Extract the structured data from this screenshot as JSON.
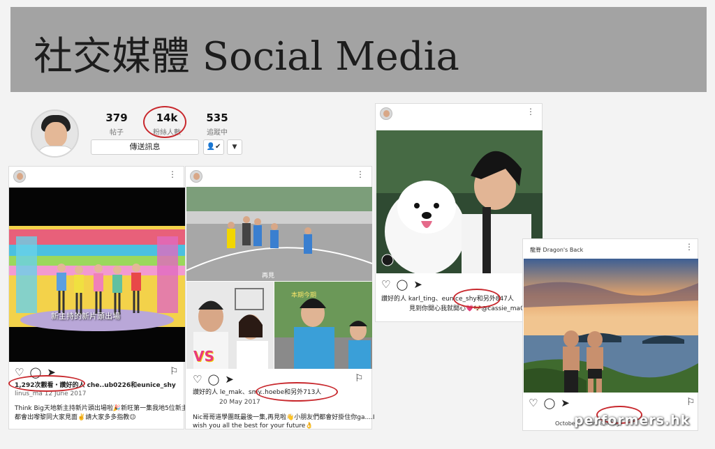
{
  "title": "社交媒體 Social Media",
  "profile": {
    "posts_count": "379",
    "posts_label": "帖子",
    "followers_count": "14k",
    "followers_label": "粉絲人數",
    "following_count": "535",
    "following_label": "追蹤中",
    "message_button": "傳送訊息",
    "follow_icon": "👤✔",
    "dropdown_icon": "▼"
  },
  "post1": {
    "views": "1,292次觀看・讚好的人 che..ub0226和eunice_shy",
    "author_line": "linus_ma 12 June 2017",
    "caption_line1": "Think Big天地新主持新片頭出場啦🎉新旺第一集我地5位新主持",
    "caption_line2": "都會出嚟黎同大家見面✌️請大家多多指教😉",
    "screen_text": "新主持的新片頭出場"
  },
  "post2": {
    "likes": "讚好的人 le_mak、smy..hoebe和另外713人",
    "date": "20 May 2017",
    "caption_line1": "Nic哥哥道學團既最後一集,再見啦👋小朋友們都會好掛住你ga....I",
    "caption_line2": "wish you all the best for your future👌",
    "photo_text_top": "再見",
    "photo_text_vs": "VS",
    "photo_text_sign": "本期今期"
  },
  "post3": {
    "likes": "讚好的人 karl_ting、eunice_shy和另外847人",
    "caption": "見到你開心我就開心💗🐶@cassie_ma0311"
  },
  "post4": {
    "location": "龍脊 Dragon's Back",
    "date": "October 5 · Mrs & Ming"
  },
  "watermark": "performers.hk",
  "colors": {
    "title_bar": "#a3a3a3",
    "highlight_ring": "#c8282d"
  }
}
